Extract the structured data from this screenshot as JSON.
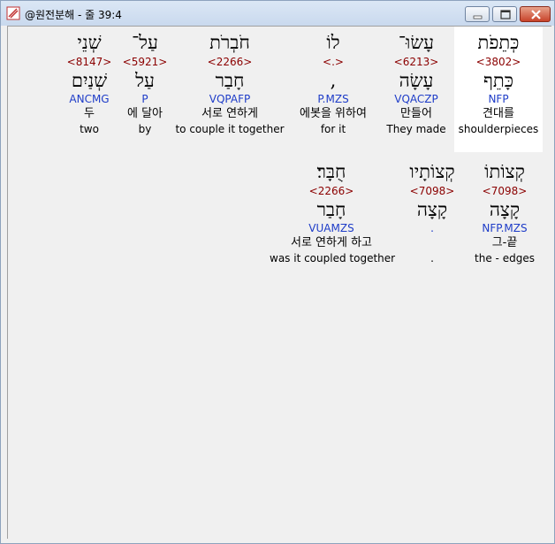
{
  "window": {
    "title": "@원전분해 - 줄 39:4"
  },
  "rows": [
    {
      "words": [
        {
          "hebrew": "כְּתֵפֹת",
          "strong": "<3802>",
          "lemma": "כָּתֵף",
          "morph": "NFP",
          "korean": "견대를",
          "english": "shoulderpieces",
          "selected": true
        },
        {
          "hebrew": "עָשׂוּ־",
          "strong": "<6213>",
          "lemma": "עָשָׂה",
          "morph": "VQACZP",
          "korean": "만들어",
          "english": "They made"
        },
        {
          "hebrew": "לוֹ",
          "strong": "<.>",
          "lemma": ",",
          "morph": "P.MZS",
          "korean": "에봇을 위하여",
          "english": "for it"
        },
        {
          "hebrew": "חֹבְרֹת",
          "strong": "<2266>",
          "lemma": "חָבַר",
          "morph": "VQPAFP",
          "korean": "서로 연하게",
          "english": "to couple it together"
        },
        {
          "hebrew": "עַל־",
          "strong": "<5921>",
          "lemma": "עַל",
          "morph": "P",
          "korean": "에 달아",
          "english": "by"
        },
        {
          "hebrew": "שְׁנֵי",
          "strong": "<8147>",
          "lemma": "שְׁנַיִם",
          "morph": "ANCMG",
          "korean": "두",
          "english": "two"
        }
      ]
    },
    {
      "words": [
        {
          "hebrew": "קְצוֹתוֹ",
          "strong": "<7098>",
          "lemma": "קָצָה",
          "morph": "NFP.MZS",
          "korean": "그-끝",
          "english": "the - edges"
        },
        {
          "hebrew": "קְצוֹתָיו",
          "strong": "<7098>",
          "lemma": "קָצָה",
          "morph": ".",
          "korean": "",
          "english": "."
        },
        {
          "hebrew": "חֻבָּר׃",
          "strong": "<2266>",
          "lemma": "חָבַר",
          "morph": "VUAMZS",
          "korean": "서로 연하게 하고",
          "english": "was it coupled together"
        }
      ]
    }
  ]
}
